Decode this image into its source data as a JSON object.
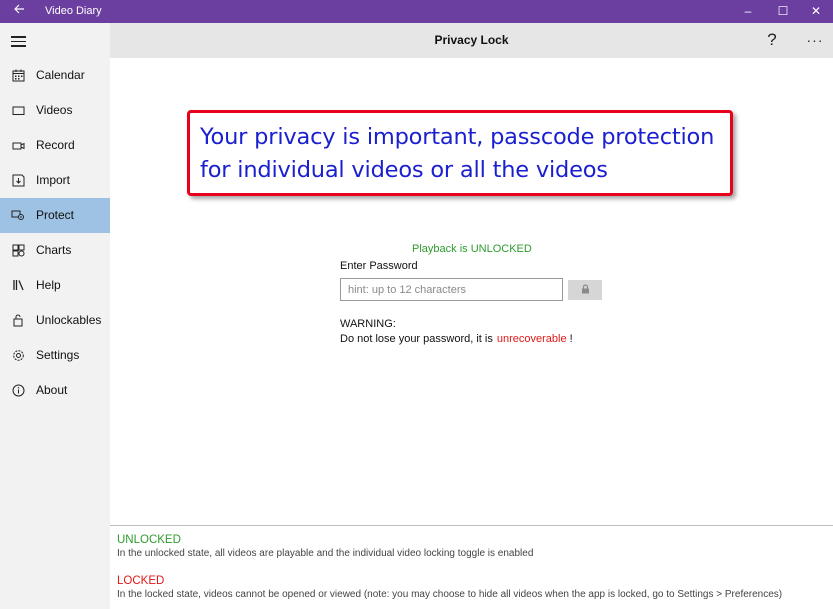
{
  "window": {
    "title": "Video Diary",
    "back_icon": "back-arrow-icon",
    "minimize": "–",
    "maximize": "☐",
    "close": "✕",
    "accent_color": "#6b3fa0"
  },
  "sidebar": {
    "selected_color": "#9dc2e3",
    "items": [
      {
        "label": "Calendar",
        "icon": "calendar-icon"
      },
      {
        "label": "Videos",
        "icon": "videos-icon"
      },
      {
        "label": "Record",
        "icon": "record-icon"
      },
      {
        "label": "Import",
        "icon": "import-icon"
      },
      {
        "label": "Protect",
        "icon": "protect-icon",
        "selected": true
      },
      {
        "label": "Charts",
        "icon": "charts-icon"
      },
      {
        "label": "Help",
        "icon": "help-books-icon"
      },
      {
        "label": "Unlockables",
        "icon": "unlockables-icon"
      },
      {
        "label": "Settings",
        "icon": "gear-icon"
      },
      {
        "label": "About",
        "icon": "info-icon"
      }
    ]
  },
  "header": {
    "title": "Privacy Lock",
    "help": "?",
    "more": "···"
  },
  "callout": {
    "text": "Your privacy is important, passcode protection for individual videos or all the videos"
  },
  "lock": {
    "status": "Playback is UNLOCKED",
    "password_label": "Enter Password",
    "password_placeholder": "hint: up to 12 characters",
    "password_value": "",
    "lock_button_icon": "lock-icon"
  },
  "warning": {
    "title": "WARNING:",
    "text": "Do not lose your password, it is",
    "emphasis": "unrecoverable",
    "suffix": "!"
  },
  "legend": {
    "unlocked_title": "UNLOCKED",
    "unlocked_desc": "In the unlocked state, all videos are playable and the individual video locking toggle is enabled",
    "locked_title": "LOCKED",
    "locked_desc": "In the locked state, videos cannot be opened or viewed (note: you may choose to hide all videos when the app is locked, go to Settings > Preferences)"
  }
}
